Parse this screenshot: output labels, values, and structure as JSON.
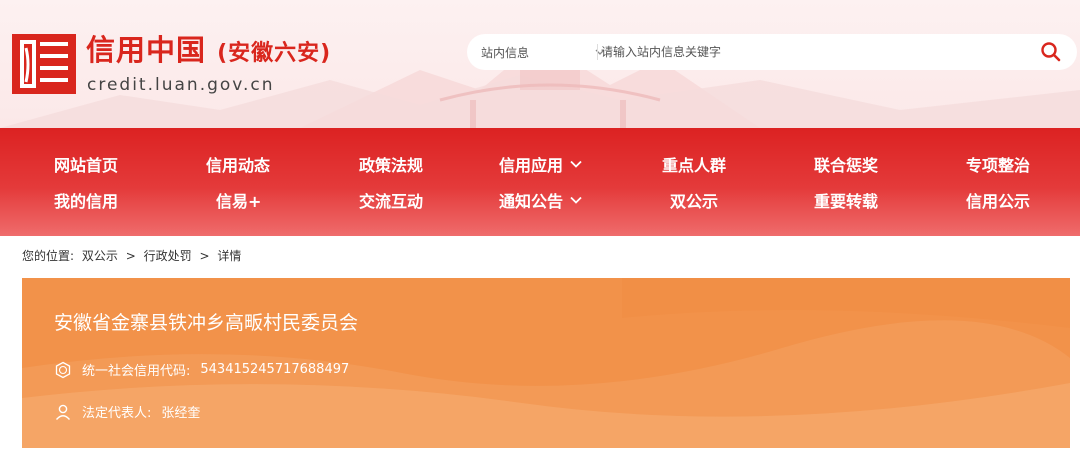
{
  "header": {
    "site_name": "信用中国",
    "site_region": "(安徽六安)",
    "site_domain": "credit.luan.gov.cn",
    "logo_icon": "credit-china-logo-icon"
  },
  "search": {
    "scope_label": "站内信息",
    "placeholder": "请输入站内信息关键字",
    "button_icon": "search-icon"
  },
  "nav": {
    "row1": [
      {
        "label": "网站首页"
      },
      {
        "label": "信用动态"
      },
      {
        "label": "政策法规"
      },
      {
        "label": "信用应用"
      },
      {
        "label": "重点人群"
      },
      {
        "label": "联合惩奖"
      },
      {
        "label": "专项整治"
      }
    ],
    "row2": [
      {
        "label": "我的信用"
      },
      {
        "label": "信易+"
      },
      {
        "label": "交流互动"
      },
      {
        "label": "通知公告"
      },
      {
        "label": "双公示"
      },
      {
        "label": "重要转载"
      },
      {
        "label": "信用公示"
      }
    ]
  },
  "breadcrumb": {
    "prefix": "您的位置:",
    "items": [
      "双公示",
      "行政处罚",
      "详情"
    ],
    "separator": ">"
  },
  "entity": {
    "name": "安徽省金寨县铁冲乡高畈村民委员会",
    "credit_code_label": "统一社会信用代码:",
    "credit_code": "543415245717688497",
    "legal_rep_label": "法定代表人:",
    "legal_rep": "张经奎"
  },
  "colors": {
    "brand_red": "#d9261d",
    "nav_red": "#dc2222",
    "card_orange": "#f2924a"
  }
}
